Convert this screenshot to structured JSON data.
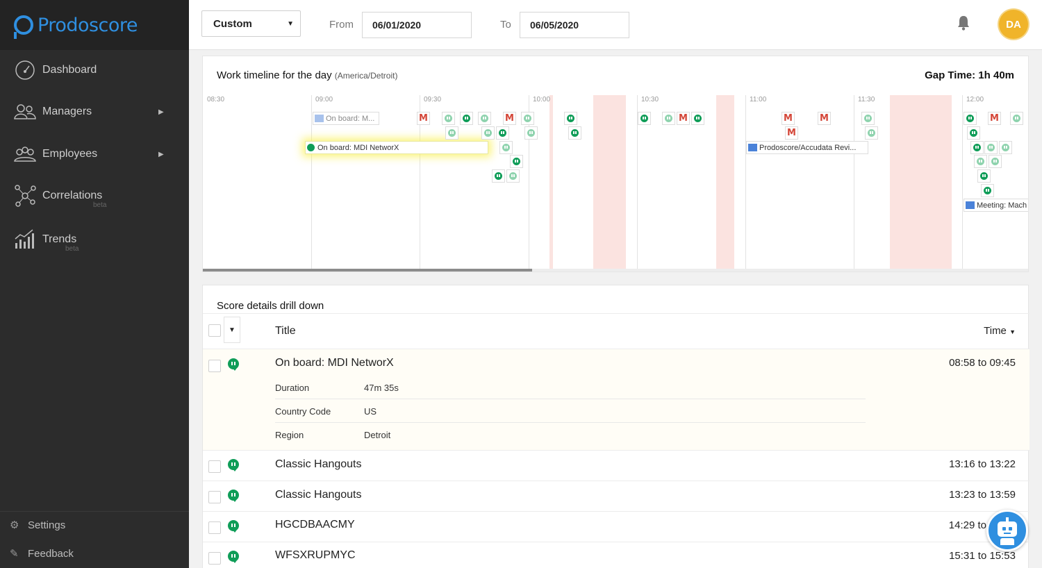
{
  "app": {
    "name": "Prodoscore"
  },
  "sidebar": {
    "items": [
      {
        "label": "Dashboard",
        "icon": "gauge-icon"
      },
      {
        "label": "Managers",
        "icon": "managers-icon",
        "has_submenu": true
      },
      {
        "label": "Employees",
        "icon": "employees-icon",
        "has_submenu": true
      },
      {
        "label": "Correlations",
        "icon": "network-icon",
        "badge": "beta"
      },
      {
        "label": "Trends",
        "icon": "bar-trend-icon",
        "badge": "beta"
      }
    ],
    "footer": [
      {
        "label": "Settings",
        "icon": "gear-icon"
      },
      {
        "label": "Feedback",
        "icon": "feedback-icon"
      }
    ]
  },
  "topbar": {
    "range_select": "Custom",
    "from_label": "From",
    "from_value": "06/01/2020",
    "to_label": "To",
    "to_value": "06/05/2020",
    "avatar_initials": "DA"
  },
  "timeline": {
    "title": "Work timeline for the day",
    "timezone": "(America/Detroit)",
    "gap_time_label": "Gap Time: 1h 40m",
    "ticks": [
      "08:30",
      "09:00",
      "09:30",
      "10:00",
      "10:30",
      "11:00",
      "11:30",
      "12:00"
    ],
    "meetings": [
      {
        "label": "On board: M..."
      },
      {
        "label": "On board: MDI NetworX"
      },
      {
        "label": "Prodoscore/Accudata Revi..."
      },
      {
        "label": "Meeting: Mach"
      }
    ]
  },
  "score": {
    "title": "Score details drill down",
    "col_title": "Title",
    "col_time": "Time",
    "rows": [
      {
        "title": "On board: MDI NetworX",
        "time": "08:58 to 09:45",
        "details": [
          {
            "key": "Duration",
            "value": "47m 35s"
          },
          {
            "key": "Country Code",
            "value": "US"
          },
          {
            "key": "Region",
            "value": "Detroit"
          }
        ]
      },
      {
        "title": "Classic Hangouts",
        "time": "13:16 to 13:22"
      },
      {
        "title": "Classic Hangouts",
        "time": "13:23 to 13:59"
      },
      {
        "title": "HGCDBAACMY",
        "time": "14:29 to"
      },
      {
        "title": "WFSXRUPMYC",
        "time": "15:31 to 15:53"
      }
    ]
  },
  "colors": {
    "brand": "#2f8fe0",
    "sidebar": "#2c2c2c",
    "hangouts": "#0f9d58",
    "gmail": "#d44638",
    "gap": "#fbe3e0",
    "avatar": "#f0b42a"
  }
}
